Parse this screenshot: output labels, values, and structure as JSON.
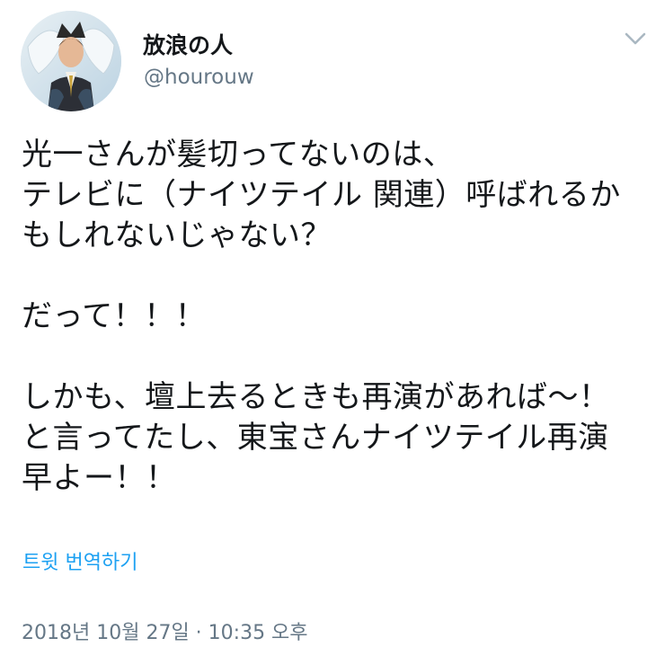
{
  "tweet": {
    "author": {
      "display_name": "放浪の人",
      "handle": "@hourouw",
      "avatar_icon": "profile-photo"
    },
    "menu_icon": "chevron-down-icon",
    "text": "光一さんが髪切ってないのは、\nテレビに（ナイツテイル 関連）呼ばれるか\nもしれないじゃない？\n\nだって！！！\n\nしかも、壇上去るときも再演があれば〜！\nと言ってたし、東宝さんナイツテイル再演\n早よー！！",
    "translate_label": "트윗 번역하기",
    "timestamp": "2018년 10월 27일 · 10:35 오후",
    "colors": {
      "link": "#1da1f2",
      "secondary_text": "#657786",
      "primary_text": "#14171a"
    }
  }
}
